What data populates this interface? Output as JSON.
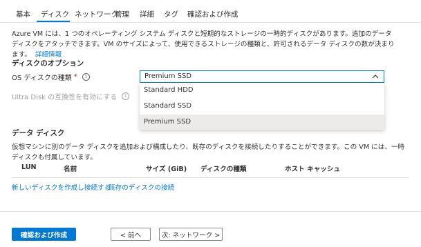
{
  "tabs": [
    {
      "label": "基本"
    },
    {
      "label": "ディスク"
    },
    {
      "label": "ネットワーク"
    },
    {
      "label": "管理"
    },
    {
      "label": "詳細"
    },
    {
      "label": "タグ"
    },
    {
      "label": "確認および作成"
    }
  ],
  "active_tab": "ディスク",
  "intro": {
    "text": "Azure VM には、1 つのオペレーティング システム ディスクと短期的なストレージの一時的ディスクがあります。追加のデータ ディスクをアタッチできます。VM のサイズによって、使用できるストレージの種類と、許可されるデータ ディスクの数が決まります。",
    "link": "詳細情報"
  },
  "disk_options": {
    "title": "ディスクのオプション",
    "os_disk_label": "OS ディスクの種類",
    "required_mark": "*",
    "ultra_label": "Ultra Disk の互換性を有効にする"
  },
  "dropdown": {
    "selected": "Premium SSD",
    "options": [
      "Standard HDD",
      "Standard SSD",
      "Premium SSD"
    ]
  },
  "data_disks": {
    "title": "データ ディスク",
    "description": "仮想マシンに別のデータ ディスクを追加および構成したり、既存のディスクを接続したりすることができます。この VM には、一時ディスクも付属しています。",
    "columns": [
      "LUN",
      "名前",
      "サイズ (GiB)",
      "ディスクの種類",
      "ホスト キャッシュ"
    ],
    "create_link": "新しいディスクを作成し接続する",
    "attach_link": "既存のディスクの接続"
  },
  "footer": {
    "review_button": "確認および作成",
    "prev_button": "< 前へ",
    "next_button": "次: ネットワーク >"
  },
  "colors": {
    "accent": "#0078d4",
    "required": "#a4262c",
    "selected_bg": "#edebe9"
  }
}
